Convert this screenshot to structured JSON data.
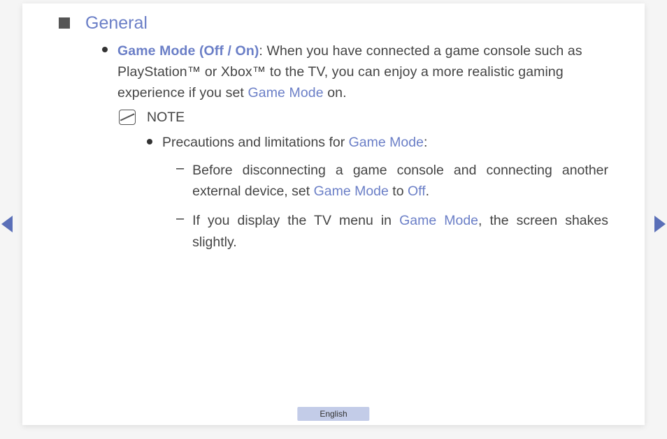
{
  "section": {
    "title": "General"
  },
  "item": {
    "label": "Game Mode (Off / On)",
    "desc_part1": ": When you have connected a game console such as PlayStation™ or Xbox™ to the TV, you can enjoy a more realistic gaming experience if you set ",
    "desc_highlight": "Game Mode",
    "desc_part2": " on."
  },
  "note": {
    "label": "NOTE"
  },
  "precaution": {
    "text_part1": "Precautions and limitations for ",
    "text_highlight": "Game Mode",
    "text_part2": ":"
  },
  "dash1": {
    "part1": "Before disconnecting a game console and connecting another external device, set ",
    "hl1": "Game Mode",
    "part2": " to ",
    "hl2": "Off",
    "part3": "."
  },
  "dash2": {
    "part1": "If you display the TV menu in ",
    "hl1": "Game Mode",
    "part2": ", the screen shakes slightly."
  },
  "footer": {
    "language": "English"
  }
}
